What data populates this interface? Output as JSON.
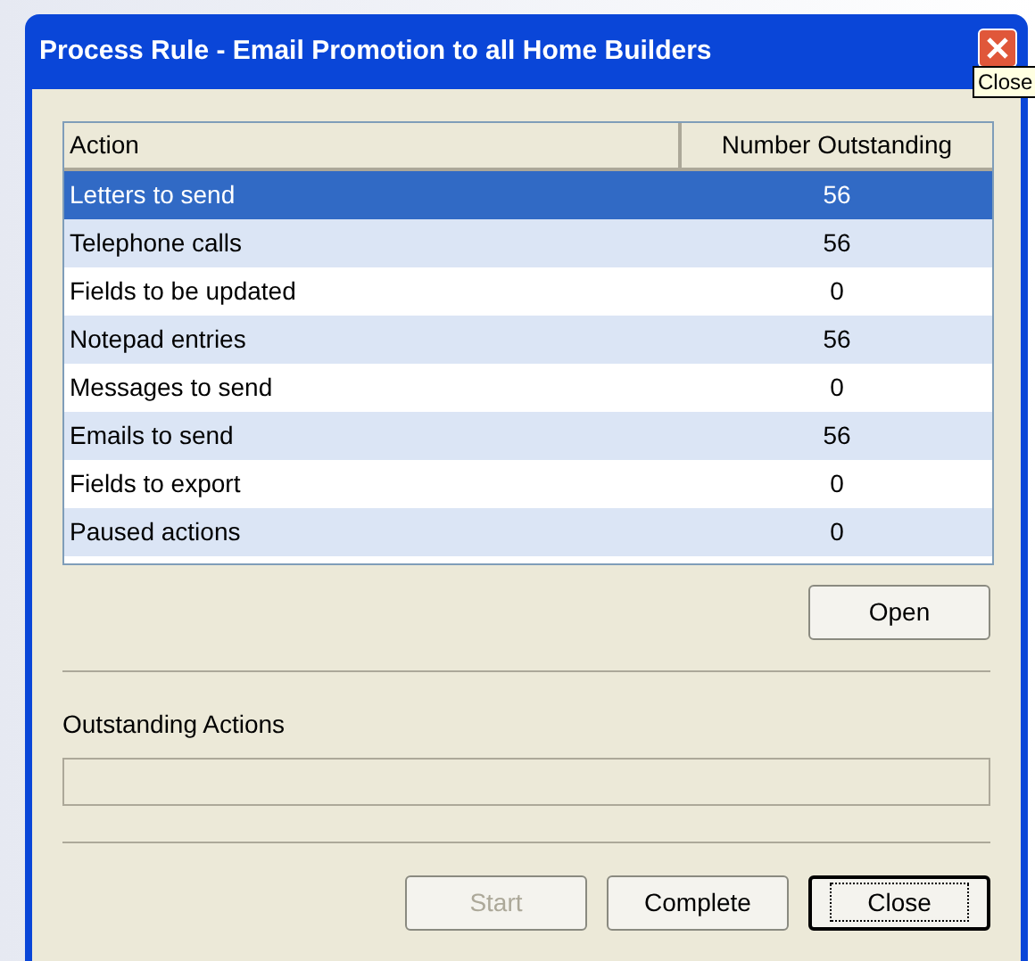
{
  "window": {
    "title": "Process Rule - Email Promotion to all Home Builders"
  },
  "tooltip": {
    "text": "Close"
  },
  "table": {
    "columns": [
      "Action",
      "Number Outstanding"
    ],
    "rows": [
      {
        "action": "Letters to send",
        "count": "56",
        "selected": true
      },
      {
        "action": "Telephone calls",
        "count": "56",
        "selected": false
      },
      {
        "action": "Fields to be updated",
        "count": "0",
        "selected": false
      },
      {
        "action": "Notepad entries",
        "count": "56",
        "selected": false
      },
      {
        "action": "Messages to send",
        "count": "0",
        "selected": false
      },
      {
        "action": "Emails to send",
        "count": "56",
        "selected": false
      },
      {
        "action": "Fields to export",
        "count": "0",
        "selected": false
      },
      {
        "action": "Paused actions",
        "count": "0",
        "selected": false
      }
    ]
  },
  "open_button": {
    "label": "Open"
  },
  "progress": {
    "label": "Outstanding Actions",
    "level": 0
  },
  "buttons": [
    {
      "label": "Start",
      "disabled": true,
      "default": false
    },
    {
      "label": "Complete",
      "disabled": false,
      "default": false
    },
    {
      "label": "Close",
      "disabled": false,
      "default": true
    }
  ]
}
